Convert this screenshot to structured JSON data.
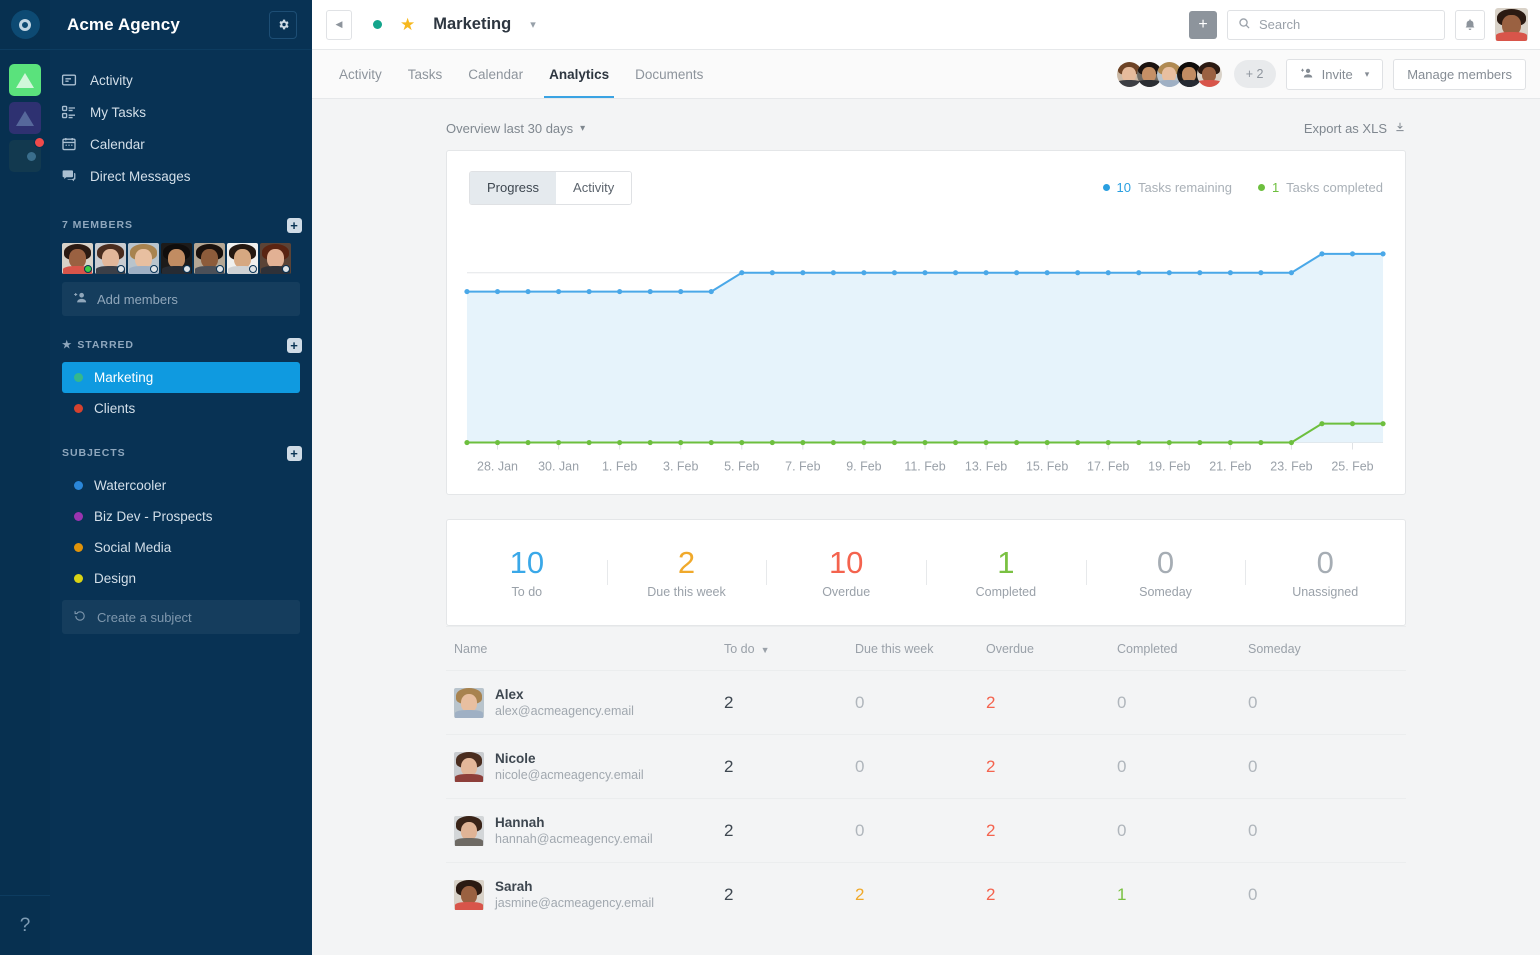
{
  "rail": {
    "logo_icon": "ring-logo-icon",
    "apps": [
      {
        "name": "app-green",
        "icon": "triangle-icon"
      },
      {
        "name": "app-indigo",
        "icon": "triangle-icon"
      },
      {
        "name": "app-dark",
        "icon": "triangle-circle-icon",
        "badge": true
      }
    ],
    "help_label": "?"
  },
  "sidebar": {
    "title": "Acme Agency",
    "gear_icon": "gear-icon",
    "nav": [
      {
        "label": "Activity",
        "icon": "activity-icon"
      },
      {
        "label": "My Tasks",
        "icon": "tasks-icon"
      },
      {
        "label": "Calendar",
        "icon": "calendar-icon"
      },
      {
        "label": "Direct Messages",
        "icon": "chat-icon"
      }
    ],
    "members_section": {
      "label": "7 Members",
      "add_icon": "plus-square-icon",
      "add_members_label": "Add members",
      "add_members_icon": "add-person-icon",
      "avatars": [
        {
          "name": "member-avatar-1",
          "status": "#3ecb46",
          "hair": "#2b1a12",
          "skin": "#9a6141",
          "bg": "#d9d2c8",
          "body": "#d8554a"
        },
        {
          "name": "member-avatar-2",
          "status": "#dfe3e6",
          "hair": "#4a2d1f",
          "skin": "#e3b79a",
          "bg": "#c9ccd0",
          "body": "#3b3f48"
        },
        {
          "name": "member-avatar-3",
          "status": "#dfe3e6",
          "hair": "#a8834f",
          "skin": "#e8bfa0",
          "bg": "#b9c4cc",
          "body": "#9fb0c4"
        },
        {
          "name": "member-avatar-4",
          "status": "#dfe3e6",
          "hair": "#100d0c",
          "skin": "#c18c62",
          "bg": "#1d1b1a",
          "body": "#262b33"
        },
        {
          "name": "member-avatar-5",
          "status": "#dfe3e6",
          "hair": "#1a110c",
          "skin": "#8d5c3b",
          "bg": "#b5a794",
          "body": "#4c5058"
        },
        {
          "name": "member-avatar-6",
          "status": "#dfe3e6",
          "hair": "#241811",
          "skin": "#d6a881",
          "bg": "#f0f0ee",
          "body": "#cfd2d4"
        },
        {
          "name": "member-avatar-7",
          "status": "#dfe3e6",
          "hair": "#5a2412",
          "skin": "#e2b194",
          "bg": "#5b4336",
          "body": "#2f3138"
        }
      ]
    },
    "starred_section": {
      "label": "Starred",
      "star_icon": "star-icon",
      "add_icon": "plus-square-icon",
      "items": [
        {
          "label": "Marketing",
          "color": "#35b88c",
          "active": true
        },
        {
          "label": "Clients",
          "color": "#d5422f",
          "active": false
        }
      ]
    },
    "subjects_section": {
      "label": "Subjects",
      "add_icon": "plus-square-icon",
      "items": [
        {
          "label": "Watercooler",
          "color": "#2a86d8"
        },
        {
          "label": "Biz Dev - Prospects",
          "color": "#9a34b0"
        },
        {
          "label": "Social Media",
          "color": "#e0930a"
        },
        {
          "label": "Design",
          "color": "#d9d315"
        }
      ],
      "create_label": "Create a subject",
      "create_icon": "refresh-icon"
    }
  },
  "topbar": {
    "collapse_icon": "chevron-left-icon",
    "project_status_color": "#14a58c",
    "star_icon": "star-icon",
    "project_name": "Marketing",
    "project_caret_icon": "chevron-down-icon",
    "add_button_icon": "plus-icon",
    "search": {
      "placeholder": "Search",
      "icon": "search-icon",
      "value": ""
    },
    "bell_icon": "bell-icon",
    "user_avatar": "user-avatar"
  },
  "tabs": {
    "items": [
      {
        "label": "Activity",
        "active": false
      },
      {
        "label": "Tasks",
        "active": false
      },
      {
        "label": "Calendar",
        "active": false
      },
      {
        "label": "Analytics",
        "active": true
      },
      {
        "label": "Documents",
        "active": false
      }
    ],
    "overflow_label": "+ 2",
    "invite_label": "Invite",
    "invite_icon": "add-person-icon",
    "invite_caret_icon": "chevron-down-icon",
    "manage_label": "Manage members",
    "avatars": [
      {
        "name": "tab-avatar-1",
        "hair": "#6d4326",
        "skin": "#e6bb9c",
        "bg": "#cbb9a6",
        "body": "#3d3f44"
      },
      {
        "name": "tab-avatar-2",
        "hair": "#1b1310",
        "skin": "#c59066",
        "bg": "#6e6a64",
        "body": "#2b2e33"
      },
      {
        "name": "tab-avatar-3",
        "hair": "#b08a52",
        "skin": "#e8bfa0",
        "bg": "#b9c4cc",
        "body": "#9fb0c4"
      },
      {
        "name": "tab-avatar-4",
        "hair": "#0f0c0b",
        "skin": "#c18c62",
        "bg": "#1d1b1a",
        "body": "#262b33"
      },
      {
        "name": "tab-avatar-5",
        "hair": "#2b1a12",
        "skin": "#9a6141",
        "bg": "#d9d2c8",
        "body": "#d8554a"
      }
    ]
  },
  "overview": {
    "range_label": "Overview last 30 days",
    "range_caret_icon": "chevron-down-icon",
    "export_label": "Export as XLS",
    "export_icon": "download-icon"
  },
  "chart_panel": {
    "segments": [
      {
        "label": "Progress",
        "active": true
      },
      {
        "label": "Activity",
        "active": false
      }
    ],
    "legend": [
      {
        "count": "10",
        "label": "Tasks remaining",
        "color": "#2a9fe0"
      },
      {
        "count": "1",
        "label": "Tasks completed",
        "color": "#6dbf3e"
      }
    ]
  },
  "chart_data": {
    "type": "area",
    "title": "",
    "xlabel": "",
    "ylabel": "",
    "grid": false,
    "legend_position": "top-right",
    "x": [
      "27. Jan",
      "28. Jan",
      "29. Jan",
      "30. Jan",
      "31. Jan",
      "1. Feb",
      "2. Feb",
      "3. Feb",
      "4. Feb",
      "5. Feb",
      "6. Feb",
      "7. Feb",
      "8. Feb",
      "9. Feb",
      "10. Feb",
      "11. Feb",
      "12. Feb",
      "13. Feb",
      "14. Feb",
      "15. Feb",
      "16. Feb",
      "17. Feb",
      "18. Feb",
      "19. Feb",
      "20. Feb",
      "21. Feb",
      "22. Feb",
      "23. Feb",
      "24. Feb",
      "25. Feb",
      "26. Feb"
    ],
    "tick_labels": [
      "28. Jan",
      "30. Jan",
      "1. Feb",
      "3. Feb",
      "5. Feb",
      "7. Feb",
      "9. Feb",
      "11. Feb",
      "13. Feb",
      "15. Feb",
      "17. Feb",
      "19. Feb",
      "21. Feb",
      "23. Feb",
      "25. Feb"
    ],
    "ylim": [
      0,
      11
    ],
    "series": [
      {
        "name": "Tasks remaining",
        "color": "#4aa8e8",
        "fill": "#e6f3fb",
        "values": [
          8,
          8,
          8,
          8,
          8,
          8,
          8,
          8,
          8,
          9,
          9,
          9,
          9,
          9,
          9,
          9,
          9,
          9,
          9,
          9,
          9,
          9,
          9,
          9,
          9,
          9,
          9,
          9,
          10,
          10,
          10
        ]
      },
      {
        "name": "Tasks completed",
        "color": "#6dbf3e",
        "fill": "#eaf5e0",
        "values": [
          0,
          0,
          0,
          0,
          0,
          0,
          0,
          0,
          0,
          0,
          0,
          0,
          0,
          0,
          0,
          0,
          0,
          0,
          0,
          0,
          0,
          0,
          0,
          0,
          0,
          0,
          0,
          0,
          1,
          1,
          1
        ]
      }
    ]
  },
  "stats": [
    {
      "value": "10",
      "label": "To do",
      "color": "#3aa8e8"
    },
    {
      "value": "2",
      "label": "Due this week",
      "color": "#f0a92b"
    },
    {
      "value": "10",
      "label": "Overdue",
      "color": "#f4634e"
    },
    {
      "value": "1",
      "label": "Completed",
      "color": "#7ac142"
    },
    {
      "value": "0",
      "label": "Someday",
      "color": "#a6adb4"
    },
    {
      "value": "0",
      "label": "Unassigned",
      "color": "#a6adb4"
    }
  ],
  "table": {
    "columns": [
      "Name",
      "To do",
      "Due this week",
      "Overdue",
      "Completed",
      "Someday"
    ],
    "sorted_column": "To do",
    "sort_icon": "caret-down-icon",
    "rows": [
      {
        "name": "Alex",
        "email": "alex@acmeagency.email",
        "avatar": {
          "hair": "#a8834f",
          "skin": "#e8bfa0",
          "bg": "#b9c4cc",
          "body": "#9fb0c4"
        },
        "todo": "2",
        "due_this_week": "0",
        "overdue": "2",
        "completed": "0",
        "someday": "0",
        "colors": {
          "todo": "#3e4750",
          "due_this_week": "#b0b6bc",
          "overdue": "#f4634e",
          "completed": "#b0b6bc",
          "someday": "#b0b6bc"
        }
      },
      {
        "name": "Nicole",
        "email": "nicole@acmeagency.email",
        "avatar": {
          "hair": "#4a2d1f",
          "skin": "#e3b79a",
          "bg": "#c9ccd0",
          "body": "#8e3f3a"
        },
        "todo": "2",
        "due_this_week": "0",
        "overdue": "2",
        "completed": "0",
        "someday": "0",
        "colors": {
          "todo": "#3e4750",
          "due_this_week": "#b0b6bc",
          "overdue": "#f4634e",
          "completed": "#b0b6bc",
          "someday": "#b0b6bc"
        }
      },
      {
        "name": "Hannah",
        "email": "hannah@acmeagency.email",
        "avatar": {
          "hair": "#3a2418",
          "skin": "#e0b496",
          "bg": "#d3d6d8",
          "body": "#6e6a64"
        },
        "todo": "2",
        "due_this_week": "0",
        "overdue": "2",
        "completed": "0",
        "someday": "0",
        "colors": {
          "todo": "#3e4750",
          "due_this_week": "#b0b6bc",
          "overdue": "#f4634e",
          "completed": "#b0b6bc",
          "someday": "#b0b6bc"
        }
      },
      {
        "name": "Sarah",
        "email": "jasmine@acmeagency.email",
        "avatar": {
          "hair": "#2b1a12",
          "skin": "#9a6141",
          "bg": "#d9d2c8",
          "body": "#d8554a"
        },
        "todo": "2",
        "due_this_week": "2",
        "overdue": "2",
        "completed": "1",
        "someday": "0",
        "colors": {
          "todo": "#3e4750",
          "due_this_week": "#f0a92b",
          "overdue": "#f4634e",
          "completed": "#7ac142",
          "someday": "#b0b6bc"
        }
      }
    ]
  }
}
